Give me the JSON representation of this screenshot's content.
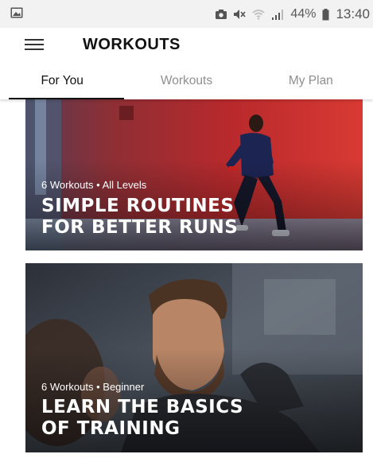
{
  "status_bar": {
    "battery": "44%",
    "time": "13:40",
    "icons": [
      "image-icon",
      "camera-icon",
      "mute-icon",
      "wifi-icon",
      "signal-icon",
      "battery-icon"
    ]
  },
  "app_bar": {
    "title": "WORKOUTS",
    "menu_icon": "hamburger-menu-icon"
  },
  "tabs": [
    {
      "label": "For You",
      "active": true
    },
    {
      "label": "Workouts",
      "active": false
    },
    {
      "label": "My Plan",
      "active": false
    }
  ],
  "cards": [
    {
      "meta": "6 Workouts • All Levels",
      "title_line1": "SIMPLE ROUTINES",
      "title_line2": "FOR BETTER RUNS"
    },
    {
      "meta": "6 Workouts • Beginner",
      "title_line1": "LEARN THE BASICS",
      "title_line2": "OF TRAINING"
    }
  ],
  "colors": {
    "accent_text": "#111111",
    "inactive_tab": "#8f8f8f",
    "status_bar_bg": "#f2f2f2"
  }
}
